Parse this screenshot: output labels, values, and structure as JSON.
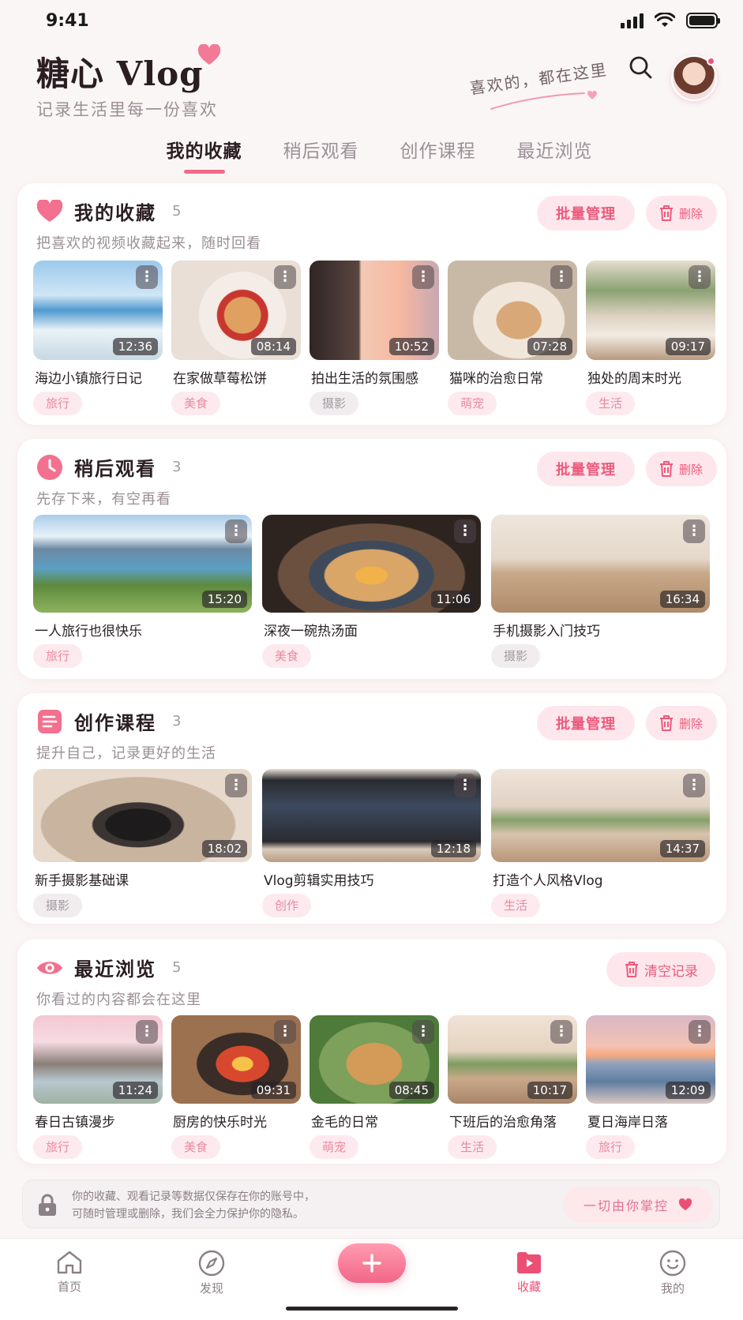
{
  "status": {
    "time": "9:41"
  },
  "header": {
    "brand": "糖心 Vlog",
    "subtitle": "记录生活里每一份喜欢",
    "slogan": "喜欢的，都在这里"
  },
  "tabs": [
    "我的收藏",
    "稍后观看",
    "创作课程",
    "最近浏览"
  ],
  "sections": {
    "favorites": {
      "title": "我的收藏",
      "count": "5",
      "desc": "把喜欢的视频收藏起来，随时回看",
      "batch": "批量管理",
      "delete": "删除",
      "items": [
        {
          "title": "海边小镇旅行日记",
          "duration": "12:36",
          "tag": "旅行"
        },
        {
          "title": "在家做草莓松饼",
          "duration": "08:14",
          "tag": "美食"
        },
        {
          "title": "拍出生活的氛围感",
          "duration": "10:52",
          "tag": "摄影"
        },
        {
          "title": "猫咪的治愈日常",
          "duration": "07:28",
          "tag": "萌宠"
        },
        {
          "title": "独处的周末时光",
          "duration": "09:17",
          "tag": "生活"
        }
      ]
    },
    "later": {
      "title": "稍后观看",
      "count": "3",
      "desc": "先存下来，有空再看",
      "batch": "批量管理",
      "delete": "删除",
      "items": [
        {
          "title": "一人旅行也很快乐",
          "duration": "15:20",
          "tag": "旅行"
        },
        {
          "title": "深夜一碗热汤面",
          "duration": "11:06",
          "tag": "美食"
        },
        {
          "title": "手机摄影入门技巧",
          "duration": "16:34",
          "tag": "摄影"
        }
      ]
    },
    "courses": {
      "title": "创作课程",
      "count": "3",
      "desc": "提升自己，记录更好的生活",
      "batch": "批量管理",
      "delete": "删除",
      "items": [
        {
          "title": "新手摄影基础课",
          "duration": "18:02",
          "tag": "摄影"
        },
        {
          "title": "Vlog剪辑实用技巧",
          "duration": "12:18",
          "tag": "创作"
        },
        {
          "title": "打造个人风格Vlog",
          "duration": "14:37",
          "tag": "生活"
        }
      ]
    },
    "recent": {
      "title": "最近浏览",
      "count": "5",
      "desc": "你看过的内容都会在这里",
      "clear": "清空记录",
      "items": [
        {
          "title": "春日古镇漫步",
          "duration": "11:24",
          "tag": "旅行"
        },
        {
          "title": "厨房的快乐时光",
          "duration": "09:31",
          "tag": "美食"
        },
        {
          "title": "金毛的日常",
          "duration": "08:45",
          "tag": "萌宠"
        },
        {
          "title": "下班后的治愈角落",
          "duration": "10:17",
          "tag": "生活"
        },
        {
          "title": "夏日海岸日落",
          "duration": "12:09",
          "tag": "旅行"
        }
      ]
    }
  },
  "privacy": {
    "line1": "你的收藏、观看记录等数据仅保存在你的账号中，",
    "line2": "可随时管理或删除，我们会全力保护你的隐私。",
    "pill": "一切由你掌控"
  },
  "nav": {
    "home": "首页",
    "discover": "发现",
    "favorites": "收藏",
    "me": "我的"
  },
  "colors": {
    "accent": "#ec4f74",
    "chip_bg": "#fdeaee"
  },
  "icons": [
    "signal-icon",
    "wifi-icon",
    "battery-icon",
    "heart-icon",
    "search-icon",
    "clock-icon",
    "note-icon",
    "eye-icon",
    "trash-icon",
    "more-icon",
    "lock-icon",
    "home-icon",
    "compass-icon",
    "plus-icon",
    "play-folder-icon",
    "smile-icon"
  ]
}
